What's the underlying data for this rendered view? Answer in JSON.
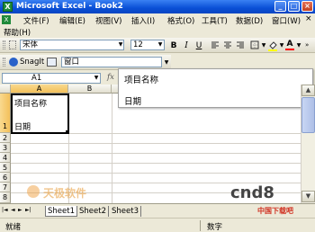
{
  "window": {
    "app_icon_glyph": "X",
    "title": "Microsoft Excel - Book2",
    "min_glyph": "_",
    "max_glyph": "□",
    "close_glyph": "×"
  },
  "menubar": {
    "items": [
      "文件(F)",
      "编辑(E)",
      "视图(V)",
      "插入(I)",
      "格式(O)",
      "工具(T)",
      "数据(D)",
      "窗口(W)"
    ],
    "help": "帮助(H)",
    "doc_close_glyph": "×"
  },
  "format_toolbar": {
    "font_name": "宋体",
    "font_size": "12",
    "bold": "B",
    "italic": "I",
    "underline": "U",
    "font_color_label": "A"
  },
  "snagit_toolbar": {
    "snagit_label": "SnagIt",
    "window_combo": "窗口"
  },
  "formula_bar": {
    "name_box": "A1",
    "fx_label": "fx"
  },
  "autocomplete": {
    "items": [
      "项目名称",
      "日期"
    ]
  },
  "grid": {
    "columns": [
      "A",
      "B"
    ],
    "rows": [
      "1",
      "2",
      "3",
      "4",
      "5",
      "6",
      "7",
      "8"
    ],
    "cell_a1_line1": "项目名称",
    "cell_a1_line2": "日期"
  },
  "sheet_tabs": {
    "nav_glyphs": [
      "|◄",
      "◄",
      "►",
      "►|"
    ],
    "tabs": [
      "Sheet1",
      "Sheet2",
      "Sheet3"
    ]
  },
  "status_bar": {
    "left": "就绪",
    "right": "数字"
  },
  "watermarks": {
    "left": "天极软件",
    "right": "cnd8",
    "right_sub": "中国下载吧"
  }
}
